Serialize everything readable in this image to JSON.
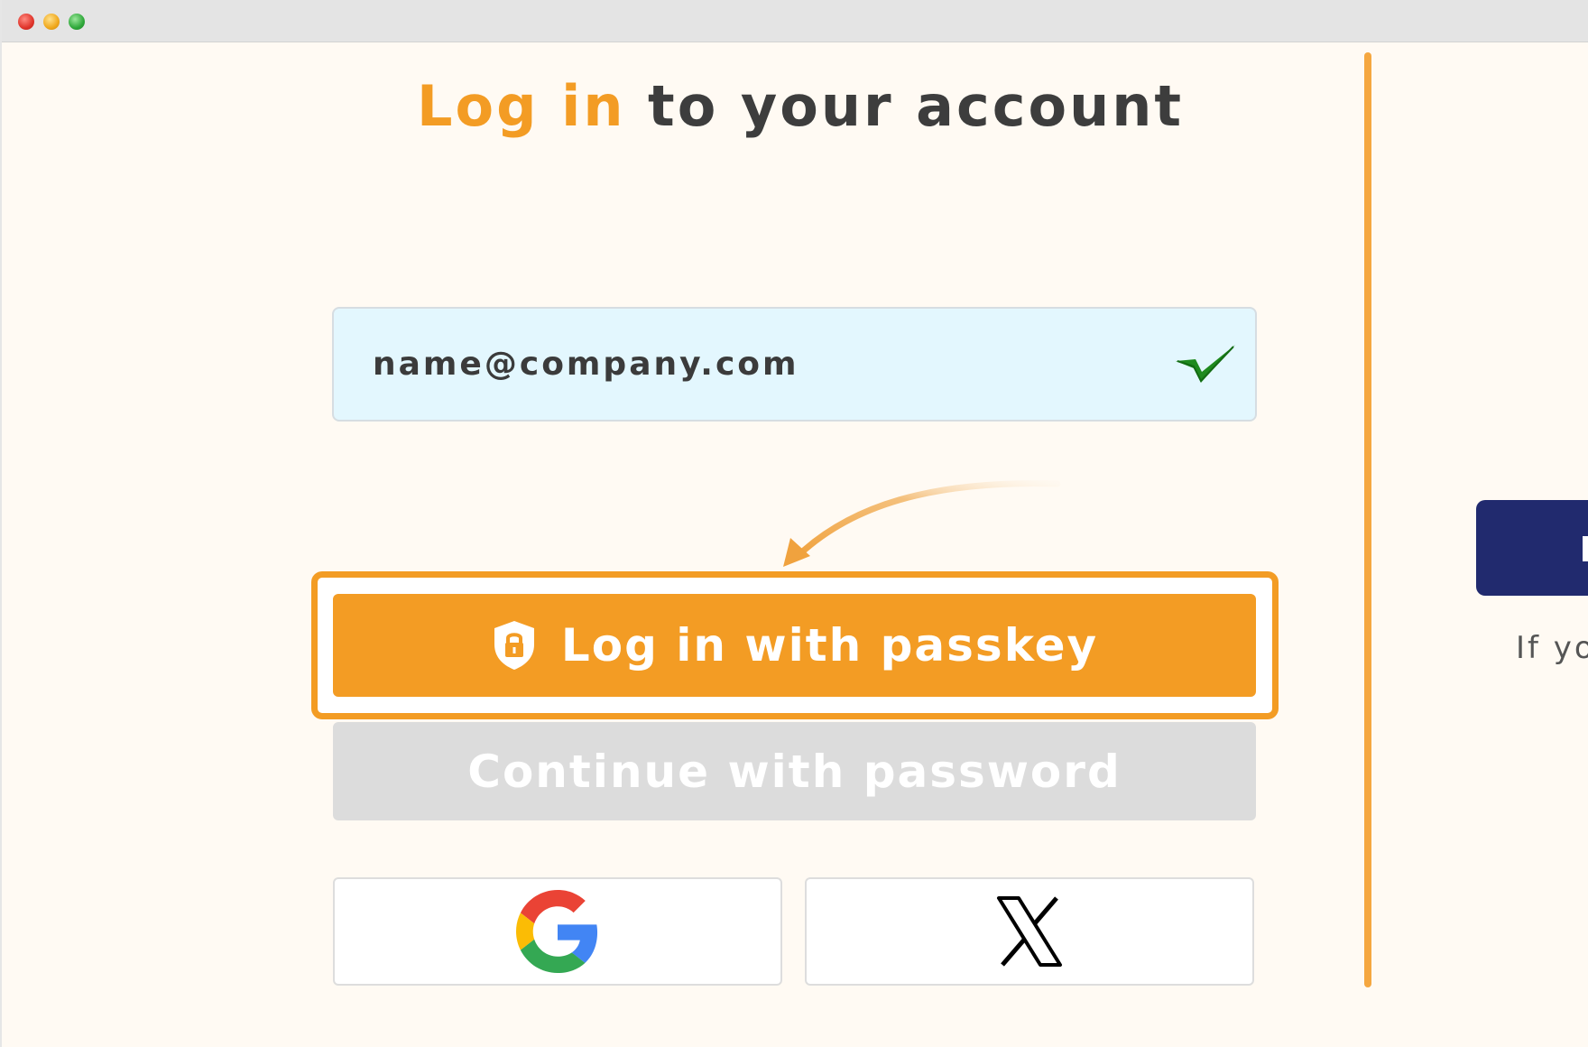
{
  "window": {
    "controls": [
      "close",
      "minimize",
      "zoom"
    ]
  },
  "title": {
    "highlight": "Log in",
    "rest": " to your account"
  },
  "email": {
    "value": "name@company.com",
    "status_icon": "check-icon"
  },
  "passkey_button": {
    "label": "Log in with passkey",
    "icon": "shield-lock-icon"
  },
  "password_button": {
    "label": "Continue with password"
  },
  "social": [
    {
      "provider": "Google",
      "icon": "google-icon"
    },
    {
      "provider": "X",
      "icon": "x-logo-icon"
    }
  ],
  "right_panel": {
    "text": "If yo"
  },
  "colors": {
    "accent": "#f39c24",
    "navy": "#212a6e",
    "field_bg": "#e3f7fe",
    "check": "#1e8a1e",
    "disabled": "#dcdcdc"
  }
}
